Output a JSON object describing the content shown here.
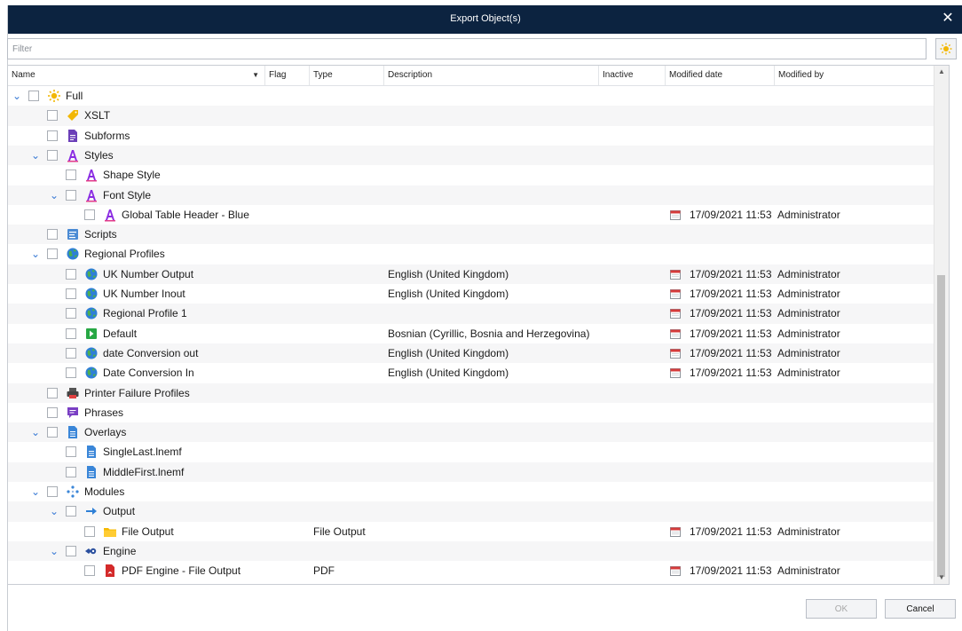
{
  "window": {
    "title": "Export Object(s)",
    "close_glyph": "✕"
  },
  "filter": {
    "placeholder": "Filter",
    "value": ""
  },
  "columns": {
    "name": "Name",
    "flag": "Flag",
    "type": "Type",
    "description": "Description",
    "inactive": "Inactive",
    "modified_date": "Modified date",
    "modified_by": "Modified by"
  },
  "colors": {
    "titlebar": "#0c2340",
    "chevron": "#3a7bd5",
    "calendar": "#d63b3b"
  },
  "rows": [
    {
      "level": 0,
      "expanded": true,
      "icon": "sun-icon",
      "label": "Full",
      "type": "",
      "description": "",
      "date": "",
      "by": ""
    },
    {
      "level": 1,
      "expanded": null,
      "icon": "tag-icon",
      "label": "XSLT",
      "type": "",
      "description": "",
      "date": "",
      "by": ""
    },
    {
      "level": 1,
      "expanded": null,
      "icon": "document-purple-icon",
      "label": "Subforms",
      "type": "",
      "description": "",
      "date": "",
      "by": ""
    },
    {
      "level": 1,
      "expanded": true,
      "icon": "font-a-icon",
      "label": "Styles",
      "type": "",
      "description": "",
      "date": "",
      "by": ""
    },
    {
      "level": 2,
      "expanded": null,
      "icon": "font-a-icon",
      "label": "Shape Style",
      "type": "",
      "description": "",
      "date": "",
      "by": ""
    },
    {
      "level": 2,
      "expanded": true,
      "icon": "font-a-icon",
      "label": "Font Style",
      "type": "",
      "description": "",
      "date": "",
      "by": ""
    },
    {
      "level": 3,
      "expanded": null,
      "icon": "font-a-icon",
      "label": "Global Table Header - Blue",
      "type": "",
      "description": "",
      "date": "17/09/2021 11:53",
      "by": "Administrator"
    },
    {
      "level": 1,
      "expanded": null,
      "icon": "script-icon",
      "label": "Scripts",
      "type": "",
      "description": "",
      "date": "",
      "by": ""
    },
    {
      "level": 1,
      "expanded": true,
      "icon": "globe-icon",
      "label": "Regional Profiles",
      "type": "",
      "description": "",
      "date": "",
      "by": ""
    },
    {
      "level": 2,
      "expanded": null,
      "icon": "globe-icon",
      "label": "UK Number Output",
      "type": "",
      "description": "English (United Kingdom)",
      "date": "17/09/2021 11:53",
      "by": "Administrator"
    },
    {
      "level": 2,
      "expanded": null,
      "icon": "globe-icon",
      "label": "UK Number Inout",
      "type": "",
      "description": "English (United Kingdom)",
      "date": "17/09/2021 11:53",
      "by": "Administrator"
    },
    {
      "level": 2,
      "expanded": null,
      "icon": "globe-icon",
      "label": "Regional Profile 1",
      "type": "",
      "description": "",
      "date": "17/09/2021 11:53",
      "by": "Administrator"
    },
    {
      "level": 2,
      "expanded": null,
      "icon": "default-green-icon",
      "label": "Default",
      "type": "",
      "description": "Bosnian (Cyrillic, Bosnia and Herzegovina)",
      "date": "17/09/2021 11:53",
      "by": "Administrator"
    },
    {
      "level": 2,
      "expanded": null,
      "icon": "globe-icon",
      "label": "date Conversion out",
      "type": "",
      "description": "English (United Kingdom)",
      "date": "17/09/2021 11:53",
      "by": "Administrator"
    },
    {
      "level": 2,
      "expanded": null,
      "icon": "globe-icon",
      "label": "Date Conversion In",
      "type": "",
      "description": "English (United Kingdom)",
      "date": "17/09/2021 11:53",
      "by": "Administrator"
    },
    {
      "level": 1,
      "expanded": null,
      "icon": "printer-icon",
      "label": "Printer Failure Profiles",
      "type": "",
      "description": "",
      "date": "",
      "by": ""
    },
    {
      "level": 1,
      "expanded": null,
      "icon": "speech-bubble-icon",
      "label": "Phrases",
      "type": "",
      "description": "",
      "date": "",
      "by": ""
    },
    {
      "level": 1,
      "expanded": true,
      "icon": "overlay-doc-icon",
      "label": "Overlays",
      "type": "",
      "description": "",
      "date": "",
      "by": ""
    },
    {
      "level": 2,
      "expanded": null,
      "icon": "overlay-doc-icon",
      "label": "SingleLast.lnemf",
      "type": "",
      "description": "",
      "date": "",
      "by": ""
    },
    {
      "level": 2,
      "expanded": null,
      "icon": "overlay-doc-icon",
      "label": "MiddleFirst.lnemf",
      "type": "",
      "description": "",
      "date": "",
      "by": ""
    },
    {
      "level": 1,
      "expanded": true,
      "icon": "modules-icon",
      "label": "Modules",
      "type": "",
      "description": "",
      "date": "",
      "by": ""
    },
    {
      "level": 2,
      "expanded": true,
      "icon": "arrow-right-icon",
      "label": "Output",
      "type": "",
      "description": "",
      "date": "",
      "by": ""
    },
    {
      "level": 3,
      "expanded": null,
      "icon": "folder-icon",
      "label": "File Output",
      "type": "File Output",
      "description": "",
      "date": "17/09/2021 11:53",
      "by": "Administrator"
    },
    {
      "level": 2,
      "expanded": true,
      "icon": "engine-icon",
      "label": "Engine",
      "type": "",
      "description": "",
      "date": "",
      "by": ""
    },
    {
      "level": 3,
      "expanded": null,
      "icon": "pdf-icon",
      "label": "PDF Engine - File Output",
      "type": "PDF",
      "description": "",
      "date": "17/09/2021 11:53",
      "by": "Administrator"
    }
  ],
  "buttons": {
    "ok": "OK",
    "cancel": "Cancel"
  }
}
